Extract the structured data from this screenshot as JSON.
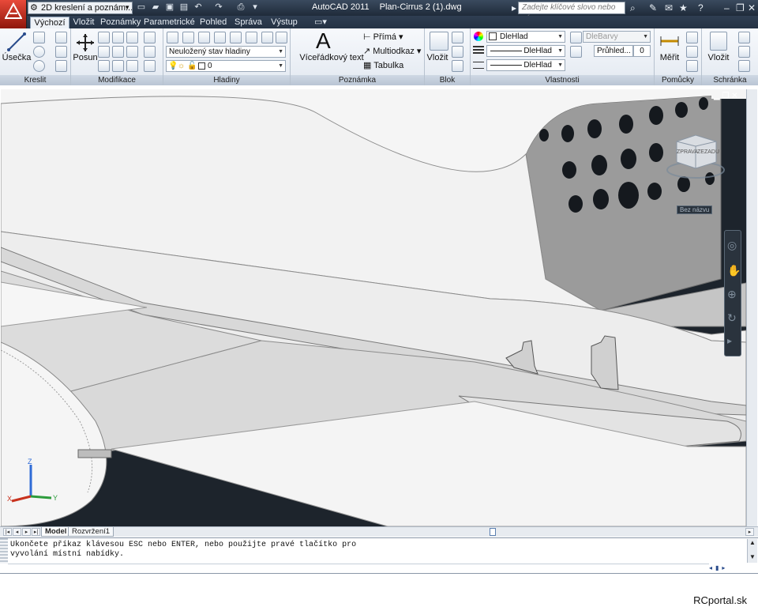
{
  "titlebar": {
    "workspace": "2D kreslení a poznám...",
    "app_name": "AutoCAD 2011",
    "file_name": "Plan-Cirrus 2 (1).dwg",
    "search_placeholder": "Zadejte klíčové slovo nebo výraz."
  },
  "tabs": [
    "Výchozí",
    "Vložit",
    "Poznámky",
    "Parametrické",
    "Pohled",
    "Správa",
    "Výstup"
  ],
  "ribbon": {
    "kreslit": {
      "title": "Kreslit",
      "line": "Úsečka"
    },
    "modifikace": {
      "title": "Modifikace",
      "move": "Posun"
    },
    "hladiny": {
      "title": "Hladiny",
      "state": "Neuložený stav hladiny",
      "layer": "0"
    },
    "poznamka": {
      "title": "Poznámka",
      "mtext": "Víceřádkový text",
      "dim": "Přímá",
      "mleader": "Multiodkaz",
      "table": "Tabulka"
    },
    "blok": {
      "title": "Blok",
      "insert": "Vložit"
    },
    "vlastnosti": {
      "title": "Vlastnosti",
      "color": "DleHlad",
      "linetype": "DleHlad",
      "lineweight": "DleHlad",
      "plotstyle": "DleBarvy",
      "transparency": "Průhled...",
      "transparency_val": "0"
    },
    "pomucky": {
      "title": "Pomůcky",
      "measure": "Měřit"
    },
    "schranka": {
      "title": "Schránka",
      "paste": "Vložit"
    }
  },
  "viewport": {
    "viewcube_left": "ZPRAVA",
    "viewcube_right": "ZEZADU",
    "view_label": "Bez názvu",
    "ucs_x": "X",
    "ucs_y": "Y",
    "ucs_z": "Z"
  },
  "layout_tabs": [
    "Model",
    "Rozvržení1"
  ],
  "command_line": {
    "text": "Ukončete příkaz klávesou ESC nebo ENTER, nebo použijte pravé tlačítko pro\nvyvolání místní nabídky."
  },
  "watermark": "RCportal.sk",
  "colors": {
    "titlebar": "#25313f",
    "viewport_bg": "#1d242c",
    "surface": "#f2f2f2",
    "accent": "#c8321e"
  }
}
